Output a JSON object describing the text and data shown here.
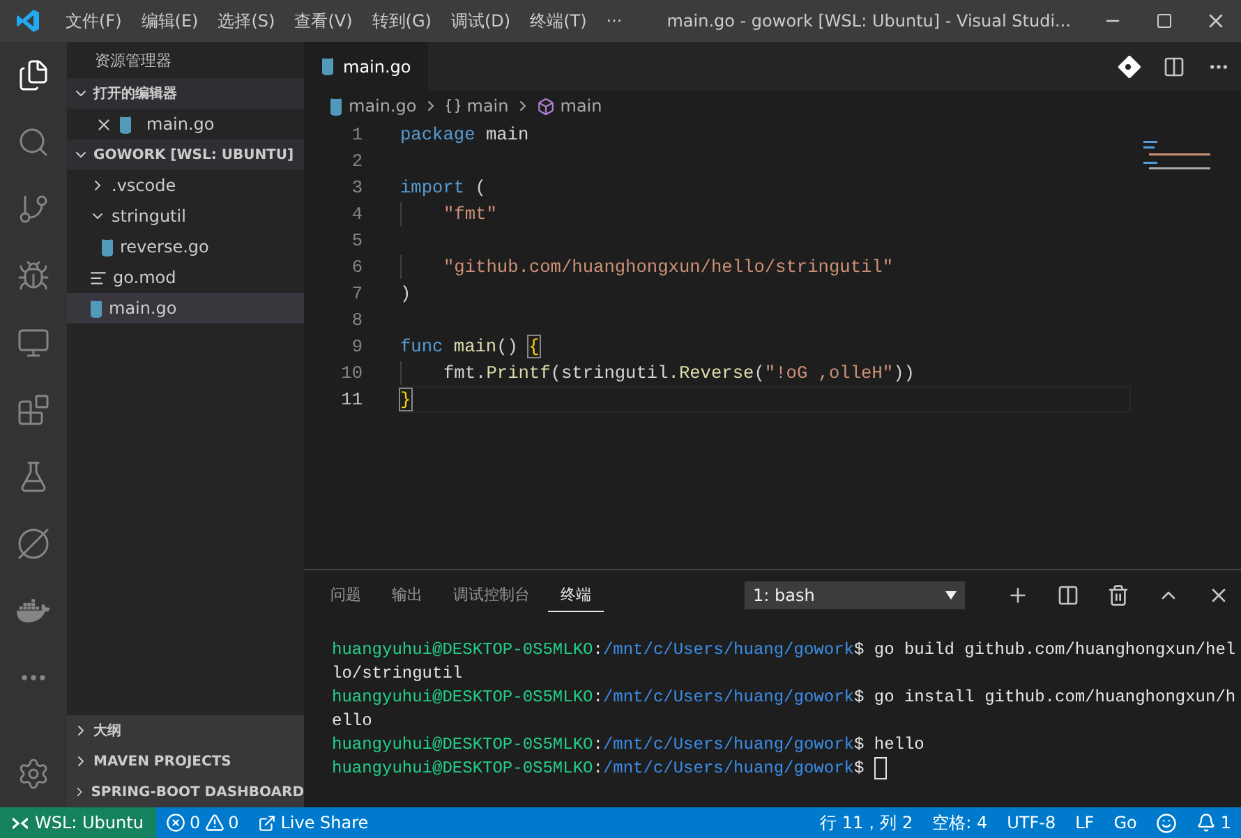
{
  "window": {
    "title": "main.go - gowork [WSL: Ubuntu] - Visual Studi..."
  },
  "menu": [
    "文件(F)",
    "编辑(E)",
    "选择(S)",
    "查看(V)",
    "转到(G)",
    "调试(D)",
    "终端(T)",
    "···"
  ],
  "sidebar": {
    "title": "资源管理器",
    "sections": [
      {
        "label": "打开的编辑器",
        "expanded": true,
        "items": [
          {
            "label": "main.go",
            "kind": "go",
            "selected": false
          }
        ]
      },
      {
        "label": "GOWORK [WSL: UBUNTU]",
        "expanded": true,
        "items": [
          {
            "label": ".vscode",
            "kind": "folder",
            "expanded": false,
            "selected": false
          },
          {
            "label": "stringutil",
            "kind": "folder",
            "expanded": true,
            "selected": false,
            "children": [
              {
                "label": "reverse.go",
                "kind": "go",
                "selected": false
              }
            ]
          },
          {
            "label": "go.mod",
            "kind": "mod",
            "selected": false
          },
          {
            "label": "main.go",
            "kind": "go",
            "selected": true
          }
        ]
      }
    ],
    "bottom_sections": [
      {
        "label": "大纲",
        "expanded": false
      },
      {
        "label": "MAVEN PROJECTS",
        "expanded": false
      },
      {
        "label": "SPRING-BOOT DASHBOARD",
        "expanded": false
      }
    ]
  },
  "editor": {
    "tabs": [
      {
        "label": "main.go",
        "selected": true
      }
    ],
    "breadcrumbs": [
      {
        "label": "main.go",
        "kind": "file"
      },
      {
        "label": "main",
        "kind": "braces"
      },
      {
        "label": "main",
        "kind": "symbol"
      }
    ],
    "lines": [
      {
        "number": "1",
        "current": false,
        "tokens": [
          {
            "text": "package",
            "kind": "keyword"
          },
          {
            "text": " main",
            "kind": "plain"
          }
        ]
      },
      {
        "number": "2",
        "current": false
      },
      {
        "number": "3",
        "current": false,
        "tokens": [
          {
            "text": "import",
            "kind": "keyword"
          },
          {
            "text": " (",
            "kind": "plain"
          }
        ]
      },
      {
        "number": "4",
        "current": false,
        "indented": true,
        "tokens": [
          {
            "text": "\"fmt\"",
            "kind": "string"
          }
        ]
      },
      {
        "number": "5",
        "current": false
      },
      {
        "number": "6",
        "current": false,
        "indented": true,
        "tokens": [
          {
            "text": "\"github.com/huanghongxun/hello/stringutil\"",
            "kind": "string"
          }
        ]
      },
      {
        "number": "7",
        "current": false,
        "tokens": [
          {
            "text": ")",
            "kind": "plain"
          }
        ]
      },
      {
        "number": "8",
        "current": false
      },
      {
        "number": "9",
        "current": false,
        "tokens": [
          {
            "text": "func",
            "kind": "keyword"
          },
          {
            "text": " main",
            "kind": "function"
          },
          {
            "text": "() ",
            "kind": "plain"
          },
          {
            "text": "{",
            "kind": "bracket"
          }
        ]
      },
      {
        "number": "10",
        "current": false,
        "indented": true,
        "tokens": [
          {
            "text": "fmt.",
            "kind": "plain"
          },
          {
            "text": "Printf",
            "kind": "function"
          },
          {
            "text": "(stringutil.",
            "kind": "plain"
          },
          {
            "text": "Reverse",
            "kind": "function"
          },
          {
            "text": "(",
            "kind": "plain"
          },
          {
            "text": "\"!oG ,olleH\"",
            "kind": "string"
          },
          {
            "text": "))",
            "kind": "plain"
          }
        ]
      },
      {
        "number": "11",
        "current": true,
        "tokens": [
          {
            "text": "}",
            "kind": "bracket"
          }
        ]
      }
    ]
  },
  "panel": {
    "tabs": [
      {
        "label": "问题",
        "selected": false
      },
      {
        "label": "输出",
        "selected": false
      },
      {
        "label": "调试控制台",
        "selected": false
      },
      {
        "label": "终端",
        "selected": true
      }
    ],
    "terminal_select": "1: bash",
    "lines": [
      [
        {
          "text": "huangyuhui@DESKTOP-0S5MLKO",
          "kind": "user"
        },
        {
          "text": ":",
          "kind": "plain"
        },
        {
          "text": "/mnt/c/Users/huang/gowork",
          "kind": "path"
        },
        {
          "text": "$ go build github.com/huanghongxun/hel",
          "kind": "plain"
        }
      ],
      [
        {
          "text": "lo/stringutil",
          "kind": "plain"
        }
      ],
      [
        {
          "text": "huangyuhui@DESKTOP-0S5MLKO",
          "kind": "user"
        },
        {
          "text": ":",
          "kind": "plain"
        },
        {
          "text": "/mnt/c/Users/huang/gowork",
          "kind": "path"
        },
        {
          "text": "$ go install github.com/huanghongxun/h",
          "kind": "plain"
        }
      ],
      [
        {
          "text": "ello",
          "kind": "plain"
        }
      ],
      [
        {
          "text": "huangyuhui@DESKTOP-0S5MLKO",
          "kind": "user"
        },
        {
          "text": ":",
          "kind": "plain"
        },
        {
          "text": "/mnt/c/Users/huang/gowork",
          "kind": "path"
        },
        {
          "text": "$ hello",
          "kind": "plain"
        }
      ],
      [
        {
          "text": "huangyuhui@DESKTOP-0S5MLKO",
          "kind": "user"
        },
        {
          "text": ":",
          "kind": "plain"
        },
        {
          "text": "/mnt/c/Users/huang/gowork",
          "kind": "path"
        },
        {
          "text": "$",
          "kind": "plain"
        },
        {
          "kind": "cursor"
        }
      ]
    ]
  },
  "status_bar": {
    "remote": "WSL: Ubuntu",
    "errors": "0",
    "warnings": "0",
    "live_share": "Live Share",
    "right": [
      {
        "text": "行 11，列 2",
        "kind": "text"
      },
      {
        "text": "空格: 4",
        "kind": "text"
      },
      {
        "text": "UTF-8",
        "kind": "text"
      },
      {
        "text": "LF",
        "kind": "text"
      },
      {
        "text": "Go",
        "kind": "text"
      },
      {
        "kind": "feedback"
      },
      {
        "text": "1",
        "kind": "bell"
      }
    ]
  }
}
